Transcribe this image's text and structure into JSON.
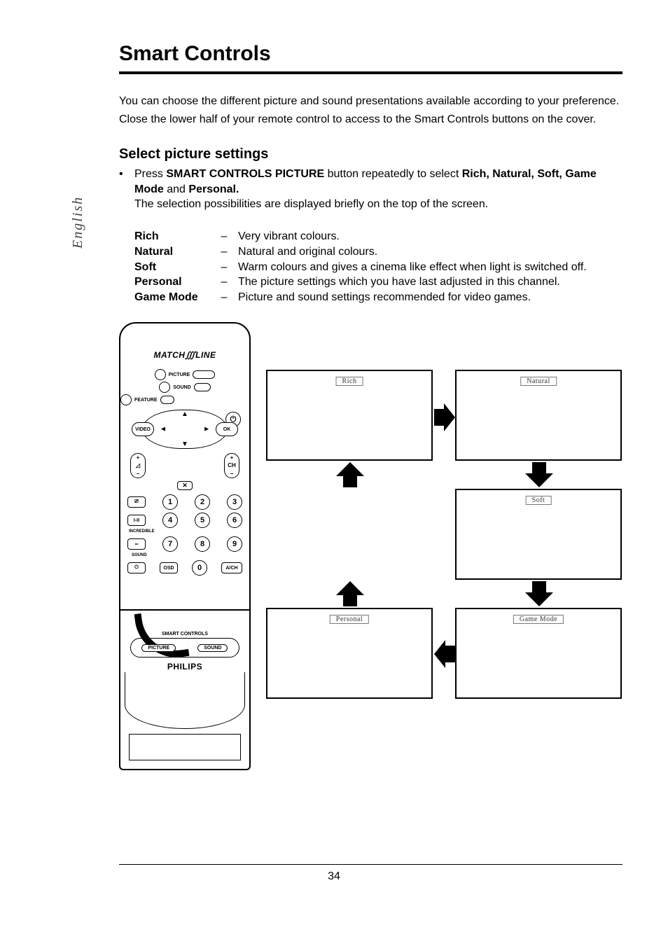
{
  "title": "Smart Controls",
  "side_label": "English",
  "intro": {
    "p1": "You can choose the different picture and sound presentations available according to your preference.",
    "p2": "Close the lower half of your remote control to access to the Smart Controls buttons on the cover."
  },
  "section": {
    "heading": "Select picture settings",
    "bullet_prefix": "Press",
    "bullet_bold1": "SMART CONTROLS PICTURE",
    "bullet_mid": "button repeatedly to select",
    "bullet_bold2": "Rich, Natural, Soft, Game Mode",
    "bullet_mid2": "and",
    "bullet_bold3": "Personal.",
    "note": "The selection possibilities are displayed briefly on the top of the screen."
  },
  "definitions": [
    {
      "term": "Rich",
      "desc": "Very vibrant colours."
    },
    {
      "term": "Natural",
      "desc": "Natural and original colours."
    },
    {
      "term": "Soft",
      "desc": "Warm colours and gives a cinema like effect when light is switched off."
    },
    {
      "term": "Personal",
      "desc": "The picture settings which you have last adjusted in this channel."
    },
    {
      "term": "Game Mode",
      "desc": "Picture and sound settings recommended for video games."
    }
  ],
  "screens": {
    "rich": "Rich",
    "natural": "Natural",
    "soft": "Soft",
    "personal": "Personal",
    "gamemode": "Game Mode"
  },
  "remote": {
    "brand_left": "MATCH",
    "brand_right": "LINE",
    "labels_mid": {
      "picture": "PICTURE",
      "sound": "SOUND",
      "feature": "FEATURE"
    },
    "power_icon": "⏻",
    "nav": {
      "video": "VIDEO",
      "ok": "OK"
    },
    "vol": {
      "plus": "+",
      "minus": "−",
      "vol_icon": "◿"
    },
    "ch": {
      "plus": "+",
      "minus": "−",
      "label": "CH"
    },
    "mute": "✕",
    "row1": {
      "left": "⎚",
      "n1": "1",
      "n2": "2",
      "n3": "3"
    },
    "row2": {
      "left": "I-II",
      "n4": "4",
      "n5": "5",
      "n6": "6"
    },
    "row3_label": "INCREDIBLE",
    "row3": {
      "left": "∞",
      "n7": "7",
      "n8": "8",
      "n9": "9"
    },
    "row3_sublabel": "SOUND",
    "row4": {
      "left": "⏻",
      "osd": "OSD",
      "n0": "0",
      "ach": "A/CH"
    },
    "smart_controls_label": "SMART CONTROLS",
    "sc_picture": "PICTURE",
    "sc_sound": "SOUND",
    "philips": "PHILIPS"
  },
  "page_number": "34"
}
